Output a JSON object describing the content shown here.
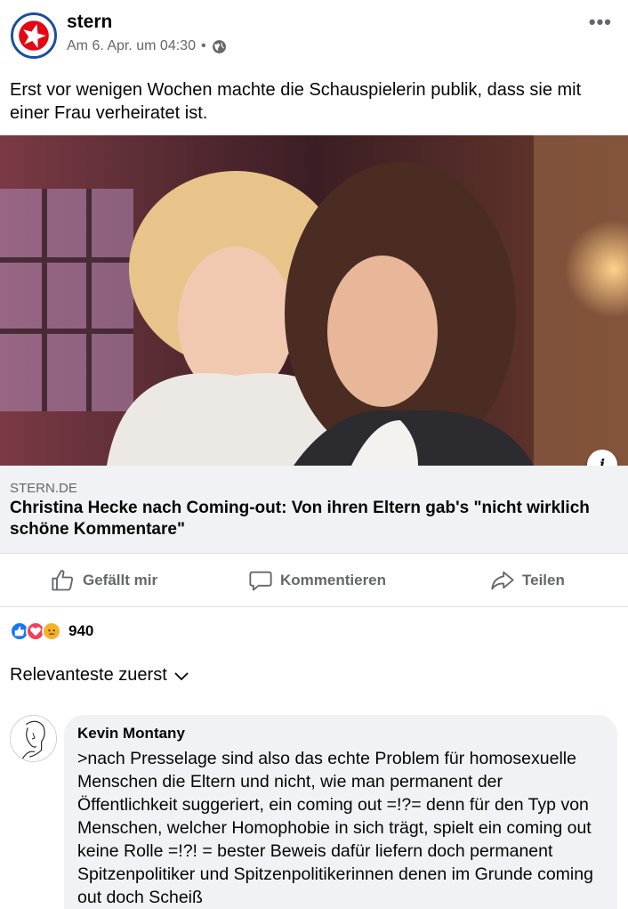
{
  "post": {
    "page_name": "stern",
    "timestamp": "Am 6. Apr. um 04:30",
    "separator": "•",
    "privacy_icon": "globe-icon",
    "more_icon": "more-horizontal-icon",
    "text": "Erst vor wenigen Wochen machte die Schauspielerin publik, dass sie mit einer Frau verheiratet ist."
  },
  "link_preview": {
    "domain": "STERN.DE",
    "title": "Christina Hecke nach Coming-out: Von ihren Eltern gab's \"nicht wirklich schöne Kommentare\"",
    "info_icon_label": "i"
  },
  "actions": {
    "like_label": "Gefällt mir",
    "comment_label": "Kommentieren",
    "share_label": "Teilen"
  },
  "reactions": {
    "count": "940",
    "types": [
      "like",
      "love",
      "sad"
    ]
  },
  "comments_sort": {
    "label": "Relevanteste zuerst"
  },
  "comment": {
    "author": "Kevin Montany",
    "text": ">nach Presselage sind also das echte Problem für homosexuelle Menschen die Eltern und nicht, wie man permanent der Öffentlichkeit suggeriert, ein coming out =!?= denn für den Typ von Menschen, welcher Homophobie in sich trägt, spielt ein coming out keine Rolle =!?! = bester Beweis dafür liefern doch permanent  Spitzenpolitiker und Spitzenpolitikerinnen denen im Grunde coming out doch Scheiß"
  },
  "colors": {
    "accent_blue": "#1877f2",
    "secondary_text": "#65676b",
    "bubble_bg": "#f0f2f5",
    "stern_red": "#e30613"
  }
}
